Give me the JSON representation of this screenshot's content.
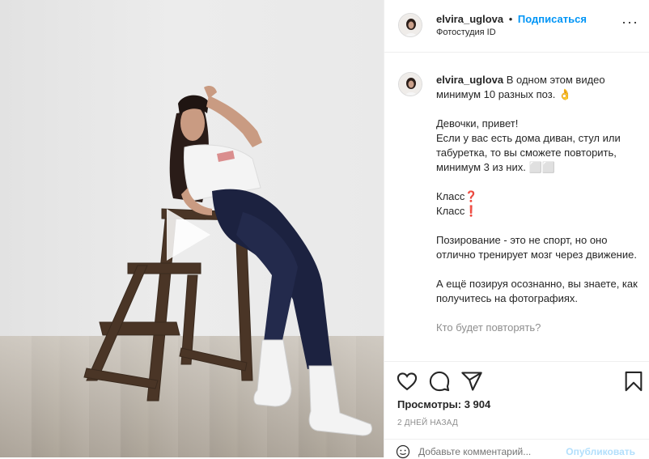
{
  "post": {
    "username": "elvira_uglova",
    "dot": "•",
    "follow_label": "Подписаться",
    "location": "Фотостудия ID",
    "more_label": "···"
  },
  "caption": {
    "username": "elvira_uglova",
    "first_line": " В одном этом видео минимум 10 разных поз.",
    "hand_emoji": "👌",
    "lines": [
      "Девочки, привет!",
      "Если у вас есть дома диван, стул или табуретка, то вы сможете повторить, минимум 3 из них. ⬜⬜",
      "Класс❓",
      "Класс❗",
      "Позирование - это не спорт, но оно отлично тренирует мозг через движение.",
      "А ещё позируя осознанно, вы знаете, как получитесь на фотографиях.",
      "Кто будет повторять?"
    ]
  },
  "actions": {
    "icons": [
      "heart-icon",
      "comment-icon",
      "share-icon",
      "bookmark-icon"
    ],
    "views_label": "Просмотры:",
    "views_count": "3 904",
    "time": "2 ДНЕЙ НАЗАД"
  },
  "comment": {
    "placeholder": "Добавьте комментарий...",
    "publish_label": "Опубликовать"
  },
  "colors": {
    "accent": "#0095f6",
    "text": "#262626",
    "muted": "#8e8e8e",
    "border": "#efefef"
  }
}
